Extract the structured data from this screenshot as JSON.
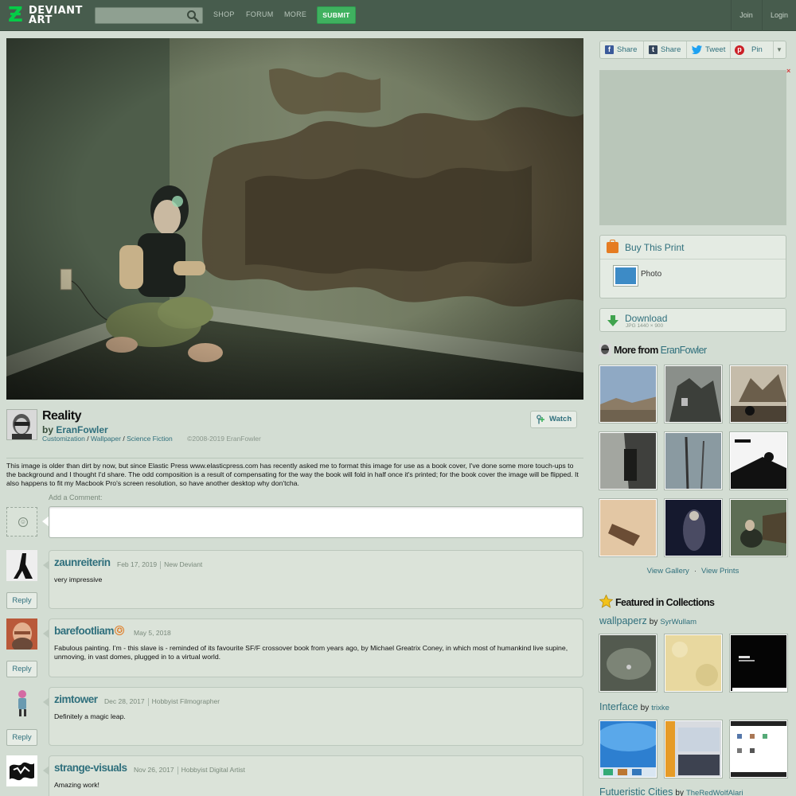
{
  "header": {
    "logo_line1": "DEVIANT",
    "logo_line2": "ART",
    "search_placeholder": "",
    "nav": [
      "SHOP",
      "FORUM",
      "MORE"
    ],
    "submit": "SUBMIT",
    "join": "Join",
    "login": "Login",
    "colors": {
      "bar": "#475c4d",
      "submit": "#3fb15f",
      "logo": "#05cc47"
    }
  },
  "deviation": {
    "title": "Reality",
    "by": "by",
    "author": "EranFowler",
    "categories": [
      "Customization",
      "Wallpaper",
      "Science Fiction"
    ],
    "category_sep": "/",
    "copyright": "©2008-2019 EranFowler",
    "watch": "Watch",
    "description": "This image is older than dirt by now, but since Elastic Press www.elasticpress.com has recently asked me to format this image for use as a book cover, I've done some more touch-ups to the background and I thought I'd share. The odd composition is a result of compensating for the way the book will fold in half once it's printed; for the book cover the image will be flipped. It also happens to fit my Macbook Pro's screen resolution, so have another desktop why don'tcha."
  },
  "comments": {
    "add_label": "Add a Comment:",
    "reply_label": "Reply",
    "items": [
      {
        "user": "zaunreiterin",
        "date": "Feb 17, 2019",
        "rank": "New Deviant",
        "text": "very impressive"
      },
      {
        "user": "barefootliam",
        "date": "May 5, 2018",
        "rank": "",
        "text": "Fabulous painting. I'm - this slave is - reminded of its favourite SF/F crossover book from years ago, by Michael Greatrix Coney, in which most of humankind live supine, unmoving, in vast domes, plugged in to a virtual world."
      },
      {
        "user": "zimtower",
        "date": "Dec 28, 2017",
        "rank": "Hobbyist Filmographer",
        "text": "Definitely a magic leap."
      },
      {
        "user": "strange-visuals",
        "date": "Nov 26, 2017",
        "rank": "Hobbyist Digital Artist",
        "text": "Amazing work!"
      }
    ]
  },
  "sidebar": {
    "share": [
      {
        "label": "Share",
        "icon": "facebook-icon"
      },
      {
        "label": "Share",
        "icon": "tumblr-icon"
      },
      {
        "label": "Tweet",
        "icon": "twitter-icon"
      },
      {
        "label": "Pin",
        "icon": "pinterest-icon"
      }
    ],
    "ad_close": "×",
    "buy_print": "Buy This Print",
    "photo": "Photo",
    "download": "Download",
    "download_meta": "JPG 1440 × 900",
    "more_from_label": "More from",
    "more_from_user": "EranFowler",
    "view_gallery": "View Gallery",
    "view_sep": "·",
    "view_prints": "View Prints",
    "featured": "Featured in Collections",
    "collections": [
      {
        "name": "wallpaperz",
        "by": "by",
        "user": "SyrWullam"
      },
      {
        "name": "Interface",
        "by": "by",
        "user": "trixke"
      },
      {
        "name": "Futueristic Cities",
        "by": "by",
        "user": "TheRedWolfAlari"
      }
    ]
  }
}
